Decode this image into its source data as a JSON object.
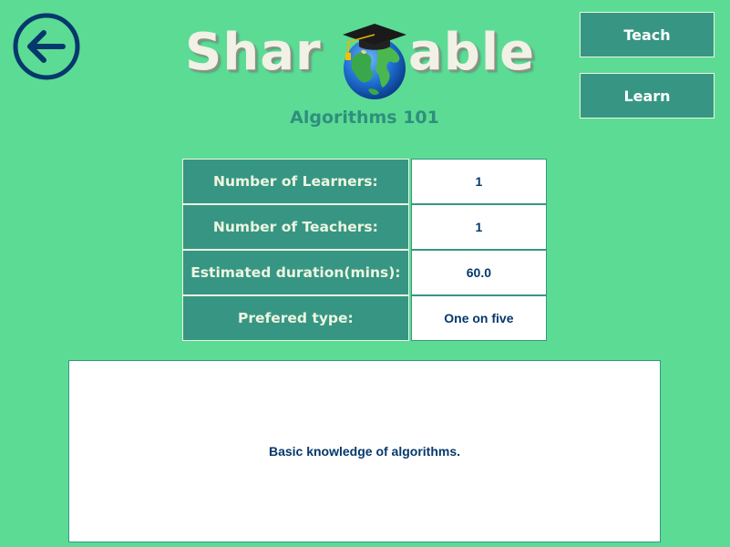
{
  "app": {
    "logo_left": "Shar",
    "logo_right": "able",
    "logo_icon": "globe-graduation-cap-icon"
  },
  "header": {
    "back_icon": "back-arrow-icon",
    "course_title": "Algorithms 101"
  },
  "nav": {
    "teach_label": "Teach",
    "learn_label": "Learn"
  },
  "details": [
    {
      "label": "Number of Learners:",
      "value": "1"
    },
    {
      "label": "Number of Teachers:",
      "value": "1"
    },
    {
      "label": "Estimated duration(mins):",
      "value": "60.0"
    },
    {
      "label": "Prefered type:",
      "value": "One on five"
    }
  ],
  "description": {
    "text": "Basic knowledge of algorithms."
  },
  "colors": {
    "background": "#5cdb95",
    "accent": "#379683",
    "dark_blue": "#05386b",
    "light": "#edf5e1"
  }
}
